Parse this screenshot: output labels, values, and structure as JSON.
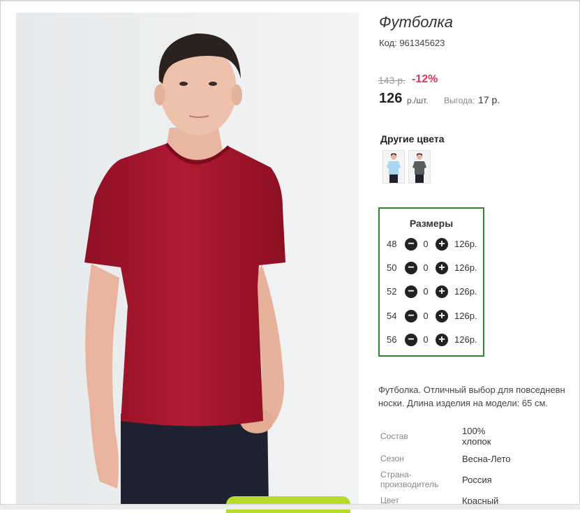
{
  "product": {
    "title": "Футболка",
    "code": "Код: 961345623",
    "old_price": "143 р.",
    "discount": "-12%",
    "price": "126",
    "unit": "р./шт.",
    "benefit_label": "Выгода:",
    "benefit_value": "17 р."
  },
  "other_colors": {
    "title": "Другие цвета",
    "swatches": [
      {
        "name": "light-blue",
        "color": "#a9d6ee"
      },
      {
        "name": "grey",
        "color": "#5b5d5f"
      }
    ]
  },
  "sizes": {
    "title": "Размеры",
    "rows": [
      {
        "size": "48",
        "qty": "0",
        "price": "126р."
      },
      {
        "size": "50",
        "qty": "0",
        "price": "126р."
      },
      {
        "size": "52",
        "qty": "0",
        "price": "126р."
      },
      {
        "size": "54",
        "qty": "0",
        "price": "126р."
      },
      {
        "size": "56",
        "qty": "0",
        "price": "126р."
      }
    ]
  },
  "description": {
    "line1": "Футболка. Отличный выбор для повседневн",
    "line2": "носки. Длина изделия на модели: 65 см."
  },
  "attributes": [
    {
      "label": "Состав",
      "value_line1": "100%",
      "value_line2": "хлопок"
    },
    {
      "label": "Сезон",
      "value_line1": "Весна-Лето"
    },
    {
      "label_line1": "Страна-",
      "label_line2": "производитель",
      "value_line1": "Россия"
    },
    {
      "label": "Цвет",
      "value_line1": "Красный"
    }
  ],
  "colors": {
    "shirt": "#a8172e",
    "accent_price": "#e0325c",
    "box_border": "#2a8a2a",
    "cart_button": "#b5dc2a"
  },
  "icons": {
    "minus": "minus-circle-icon",
    "plus": "plus-circle-icon"
  }
}
